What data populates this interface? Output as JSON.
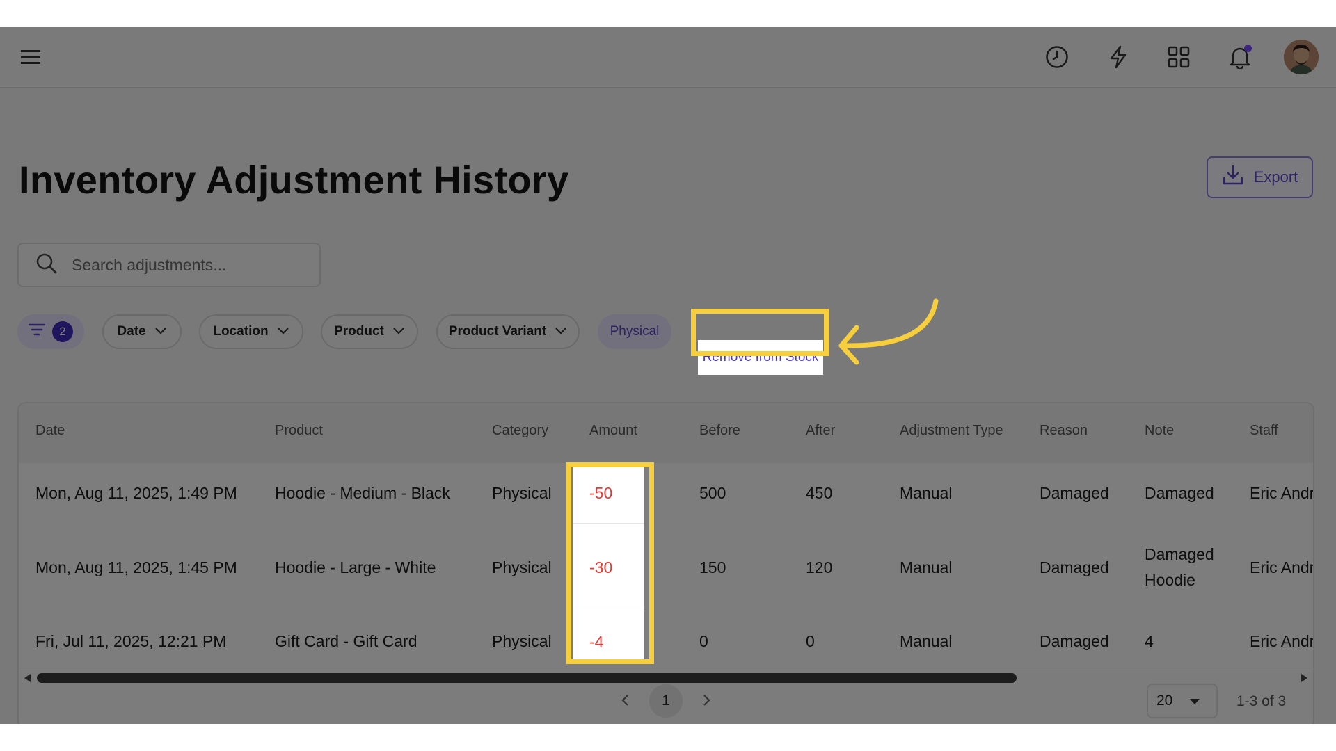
{
  "header": {
    "icons": [
      "menu-icon",
      "history-icon",
      "lightning-icon",
      "apps-grid-icon",
      "bell-icon",
      "user-avatar"
    ]
  },
  "page": {
    "title": "Inventory Adjustment History",
    "export_label": "Export"
  },
  "search": {
    "placeholder": "Search adjustments..."
  },
  "filters": {
    "active_count": "2",
    "chips": [
      "Date",
      "Location",
      "Product",
      "Product Variant"
    ],
    "active_category": "Physical",
    "active_type": "Remove from Stock"
  },
  "table": {
    "columns": [
      "Date",
      "Product",
      "Category",
      "Amount",
      "Before",
      "After",
      "Adjustment Type",
      "Reason",
      "Note",
      "Staff"
    ],
    "rows": [
      {
        "date": "Mon, Aug 11, 2025, 1:49 PM",
        "product": "Hoodie - Medium - Black",
        "category": "Physical",
        "amount": "-50",
        "before": "500",
        "after": "450",
        "type": "Manual",
        "reason": "Damaged",
        "note_line1": "Damaged",
        "note_line2": "",
        "staff": "Eric Andr"
      },
      {
        "date": "Mon, Aug 11, 2025, 1:45 PM",
        "product": "Hoodie - Large - White",
        "category": "Physical",
        "amount": "-30",
        "before": "150",
        "after": "120",
        "type": "Manual",
        "reason": "Damaged",
        "note_line1": "Damaged",
        "note_line2": "Hoodie",
        "staff": "Eric Andr"
      },
      {
        "date": "Fri, Jul 11, 2025, 12:21 PM",
        "product": "Gift Card - Gift Card",
        "category": "Physical",
        "amount": "-4",
        "before": "0",
        "after": "0",
        "type": "Manual",
        "reason": "Damaged",
        "note_line1": "4",
        "note_line2": "",
        "staff": "Eric Andr"
      }
    ]
  },
  "pagination": {
    "current_page": "1",
    "page_size": "20",
    "range": "1-3 of 3"
  },
  "colors": {
    "accent": "#5b47c8",
    "highlight": "#f7cf3d",
    "negative": "#e53935"
  }
}
